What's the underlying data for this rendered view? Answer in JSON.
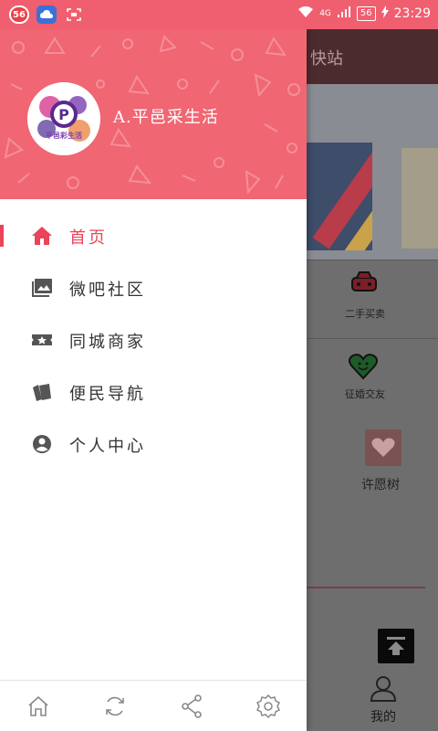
{
  "status_bar": {
    "notification_badge": "56",
    "network_label": "4G",
    "battery": "56",
    "time": "23:29"
  },
  "drawer": {
    "header": {
      "user_name": "A.平邑采生活",
      "avatar_text": "平邑彩生活"
    },
    "menu": [
      {
        "label": "首页",
        "icon": "home-icon",
        "active": true
      },
      {
        "label": "微吧社区",
        "icon": "gallery-icon",
        "active": false
      },
      {
        "label": "同城商家",
        "icon": "ticket-icon",
        "active": false
      },
      {
        "label": "便民导航",
        "icon": "cards-icon",
        "active": false
      },
      {
        "label": "个人中心",
        "icon": "person-icon",
        "active": false
      }
    ],
    "footer": [
      "home-outline-icon",
      "refresh-icon",
      "share-icon",
      "settings-icon"
    ]
  },
  "background": {
    "header_text": "快站",
    "cells": [
      {
        "label": "二手买卖",
        "icon": "car-icon"
      },
      {
        "label": "征婚交友",
        "icon": "heart-icon"
      }
    ],
    "wish_tree_label": "许愿树",
    "mine_tab_label": "我的"
  },
  "colors": {
    "accent": "#e9445a",
    "header_bg": "#f06673",
    "status_bar": "#f05f70"
  }
}
